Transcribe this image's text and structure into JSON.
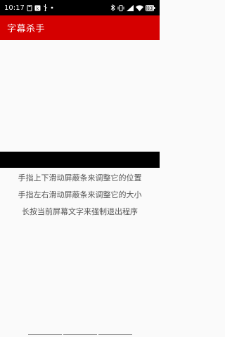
{
  "status_bar": {
    "time": "10:17",
    "left_icons": [
      "notification-icon",
      "app-icon",
      "usb-icon",
      "more-dots-icon"
    ],
    "right_icons": [
      "bluetooth-icon",
      "vibrate-icon",
      "signal-icon",
      "wifi-icon",
      "battery-icon"
    ],
    "battery_level": "83"
  },
  "app_bar": {
    "title": "字幕杀手",
    "color": "#d50000"
  },
  "instructions": [
    "手指上下滑动屏蔽条来调整它的位置",
    "手指左右滑动屏蔽条来调整它的大小",
    "长按当前屏幕文字来强制退出程序"
  ],
  "colors": {
    "background": "#fafafa",
    "mask_bar": "#000000",
    "text": "#555555"
  }
}
